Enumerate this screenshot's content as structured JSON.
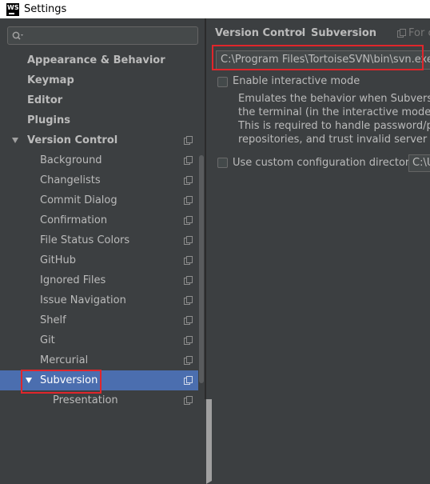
{
  "window": {
    "app_icon_text": "WS",
    "title": "Settings"
  },
  "search": {
    "value": ""
  },
  "tree": {
    "items": [
      {
        "label": "Appearance & Behavior",
        "expand": "right",
        "level": 0
      },
      {
        "label": "Keymap",
        "expand": "none",
        "level": 0
      },
      {
        "label": "Editor",
        "expand": "right",
        "level": 0
      },
      {
        "label": "Plugins",
        "expand": "none",
        "level": 0
      },
      {
        "label": "Version Control",
        "expand": "down",
        "level": 0,
        "copy_icon": true
      },
      {
        "label": "Background",
        "level": 1,
        "copy_icon": true
      },
      {
        "label": "Changelists",
        "level": 1,
        "copy_icon": true
      },
      {
        "label": "Commit Dialog",
        "level": 1,
        "copy_icon": true
      },
      {
        "label": "Confirmation",
        "level": 1,
        "copy_icon": true
      },
      {
        "label": "File Status Colors",
        "level": 1,
        "copy_icon": true
      },
      {
        "label": "GitHub",
        "level": 1,
        "copy_icon": true
      },
      {
        "label": "Ignored Files",
        "level": 1,
        "copy_icon": true
      },
      {
        "label": "Issue Navigation",
        "level": 1,
        "copy_icon": true
      },
      {
        "label": "Shelf",
        "level": 1,
        "copy_icon": true
      },
      {
        "label": "Git",
        "level": 1,
        "copy_icon": true
      },
      {
        "label": "Mercurial",
        "level": 1,
        "copy_icon": true
      },
      {
        "label": "Subversion",
        "level": 1,
        "copy_icon": true,
        "selected": true,
        "expand": "down"
      },
      {
        "label": "Presentation",
        "level": 2,
        "copy_icon": true
      }
    ]
  },
  "breadcrumb": {
    "parent": "Version Control",
    "separator": "›",
    "current": "Subversion",
    "scope_text": "For c"
  },
  "svn": {
    "executable_path": "C:\\Program Files\\TortoiseSVN\\bin\\svn.exe",
    "interactive_mode_label": "Enable interactive mode",
    "interactive_mode_checked": false,
    "description_lines": [
      "Emulates the behavior when Subversion c",
      "the terminal (in the interactive mode).",
      "This is required to handle password/pass",
      "repositories, and trust invalid server certi"
    ],
    "custom_config_label": "Use custom configuration directory:",
    "custom_config_checked": false,
    "config_dir_value": "C:\\U"
  },
  "colors": {
    "background": "#3c3f41",
    "selection": "#4b6eaf",
    "highlight_box": "#e0262b"
  }
}
